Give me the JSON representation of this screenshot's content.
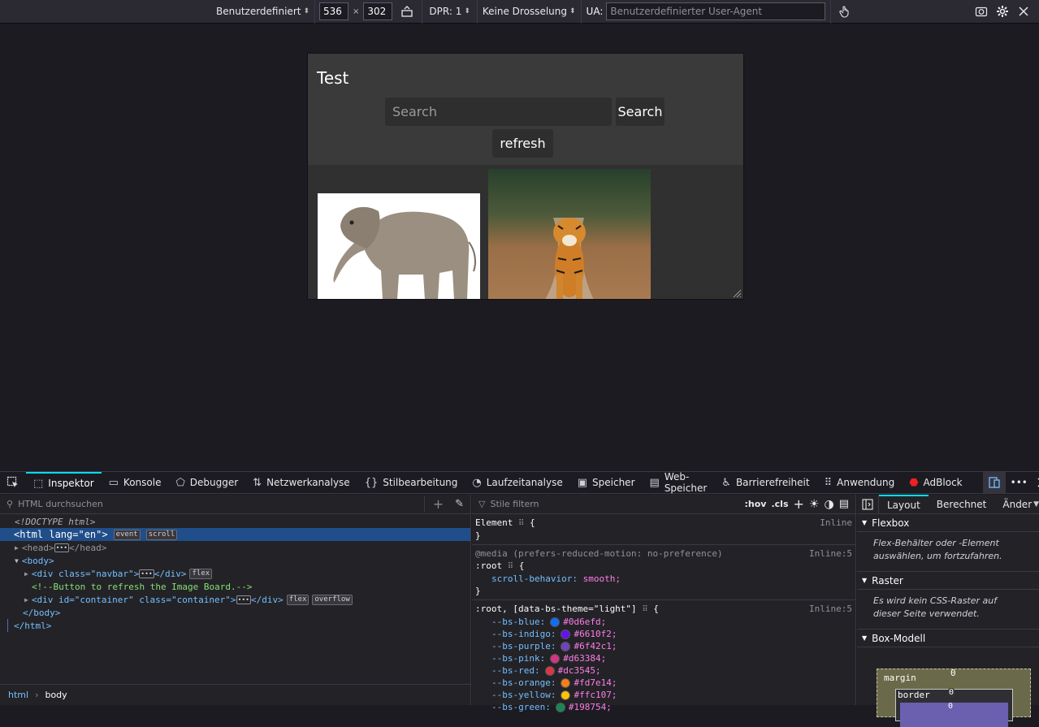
{
  "rdm_toolbar": {
    "device": "Benutzerdefiniert",
    "width": "536",
    "times": "×",
    "height": "302",
    "dpr": "DPR: 1",
    "throttle": "Keine Drosselung",
    "ua_label": "UA:",
    "ua_placeholder": "Benutzerdefinierter User-Agent"
  },
  "page": {
    "title": "Test",
    "search_placeholder": "Search",
    "search_button": "Search",
    "refresh_button": "refresh"
  },
  "devtools": {
    "tabs": [
      "Inspektor",
      "Konsole",
      "Debugger",
      "Netzwerkanalyse",
      "Stilbearbeitung",
      "Laufzeitanalyse",
      "Speicher",
      "Web-Speicher",
      "Barrierefreiheit",
      "Anwendung",
      "AdBlock"
    ],
    "html_search_placeholder": "HTML durchsuchen",
    "styles_filter_placeholder": "Stile filtern",
    "hov": ":hov",
    "cls": ".cls",
    "breadcrumb": [
      "html",
      "body"
    ]
  },
  "dom_tree": {
    "doctype": "<!DOCTYPE html>",
    "html_open": "<html lang=\"en\">",
    "badge_event": "event",
    "badge_scroll": "scroll",
    "head": "<head>",
    "head_close": "</head>",
    "body_open": "<body>",
    "navbar_open": "<div class=\"navbar\">",
    "div_close": "</div>",
    "badge_flex": "flex",
    "comment": "<!--Button to refresh the Image Board.-->",
    "container_open": "<div id=\"container\" class=\"container\">",
    "badge_overflow": "overflow",
    "body_close": "</body>",
    "html_close": "</html>"
  },
  "styles": {
    "element_selector": "Element",
    "element_brace": "{",
    "element_close": "}",
    "element_src": "Inline",
    "media": "@media (prefers-reduced-motion: no-preference)",
    "media_src": "Inline:5",
    "root_selector": ":root",
    "scroll_prop": "scroll-behavior:",
    "scroll_val": "smooth;",
    "root_rule_selector": ":root, [data-bs-theme=\"light\"]",
    "root_rule_src": "Inline:5",
    "vars": [
      {
        "name": "--bs-blue:",
        "value": "#0d6efd;",
        "color": "#0d6efd"
      },
      {
        "name": "--bs-indigo:",
        "value": "#6610f2;",
        "color": "#6610f2"
      },
      {
        "name": "--bs-purple:",
        "value": "#6f42c1;",
        "color": "#6f42c1"
      },
      {
        "name": "--bs-pink:",
        "value": "#d63384;",
        "color": "#d63384"
      },
      {
        "name": "--bs-red:",
        "value": "#dc3545;",
        "color": "#dc3545"
      },
      {
        "name": "--bs-orange:",
        "value": "#fd7e14;",
        "color": "#fd7e14"
      },
      {
        "name": "--bs-yellow:",
        "value": "#ffc107;",
        "color": "#ffc107"
      },
      {
        "name": "--bs-green:",
        "value": "#198754;",
        "color": "#198754"
      }
    ]
  },
  "layout_panel": {
    "tabs": [
      "Layout",
      "Berechnet",
      "Änder"
    ],
    "flexbox": "Flexbox",
    "flexbox_text": "Flex-Behälter oder -Element auswählen, um fortzufahren.",
    "raster": "Raster",
    "raster_text": "Es wird kein CSS-Raster auf dieser Seite verwendet.",
    "box_model": "Box-Modell",
    "margin_label": "margin",
    "margin_val": "0",
    "border_label": "border",
    "border_val": "0",
    "padding_val": "0"
  }
}
